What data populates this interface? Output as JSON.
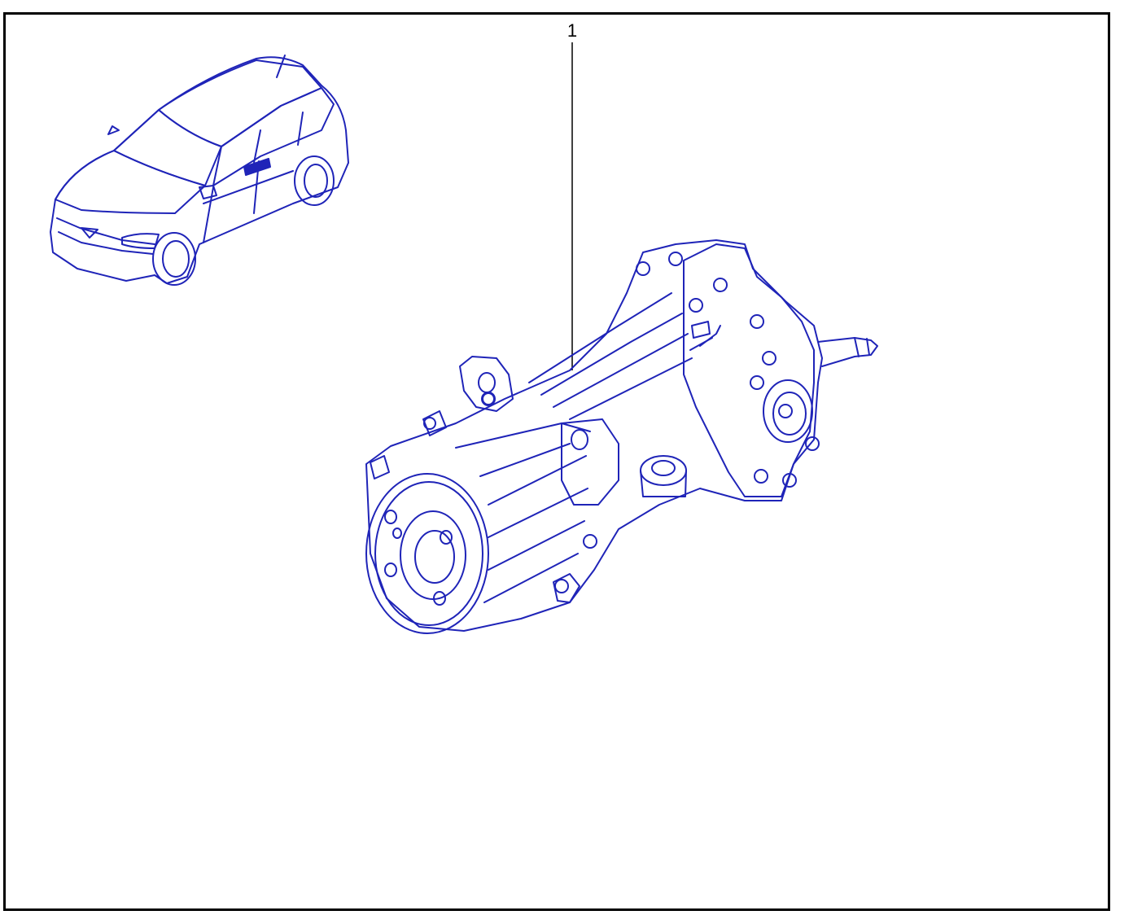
{
  "diagram": {
    "line_color": "#1f24b8",
    "frame_color": "#000000",
    "callouts": [
      {
        "label": "1"
      }
    ],
    "parts": {
      "vehicle_overview": "car-illustration",
      "main_part": "rear-differential-assembly"
    }
  }
}
